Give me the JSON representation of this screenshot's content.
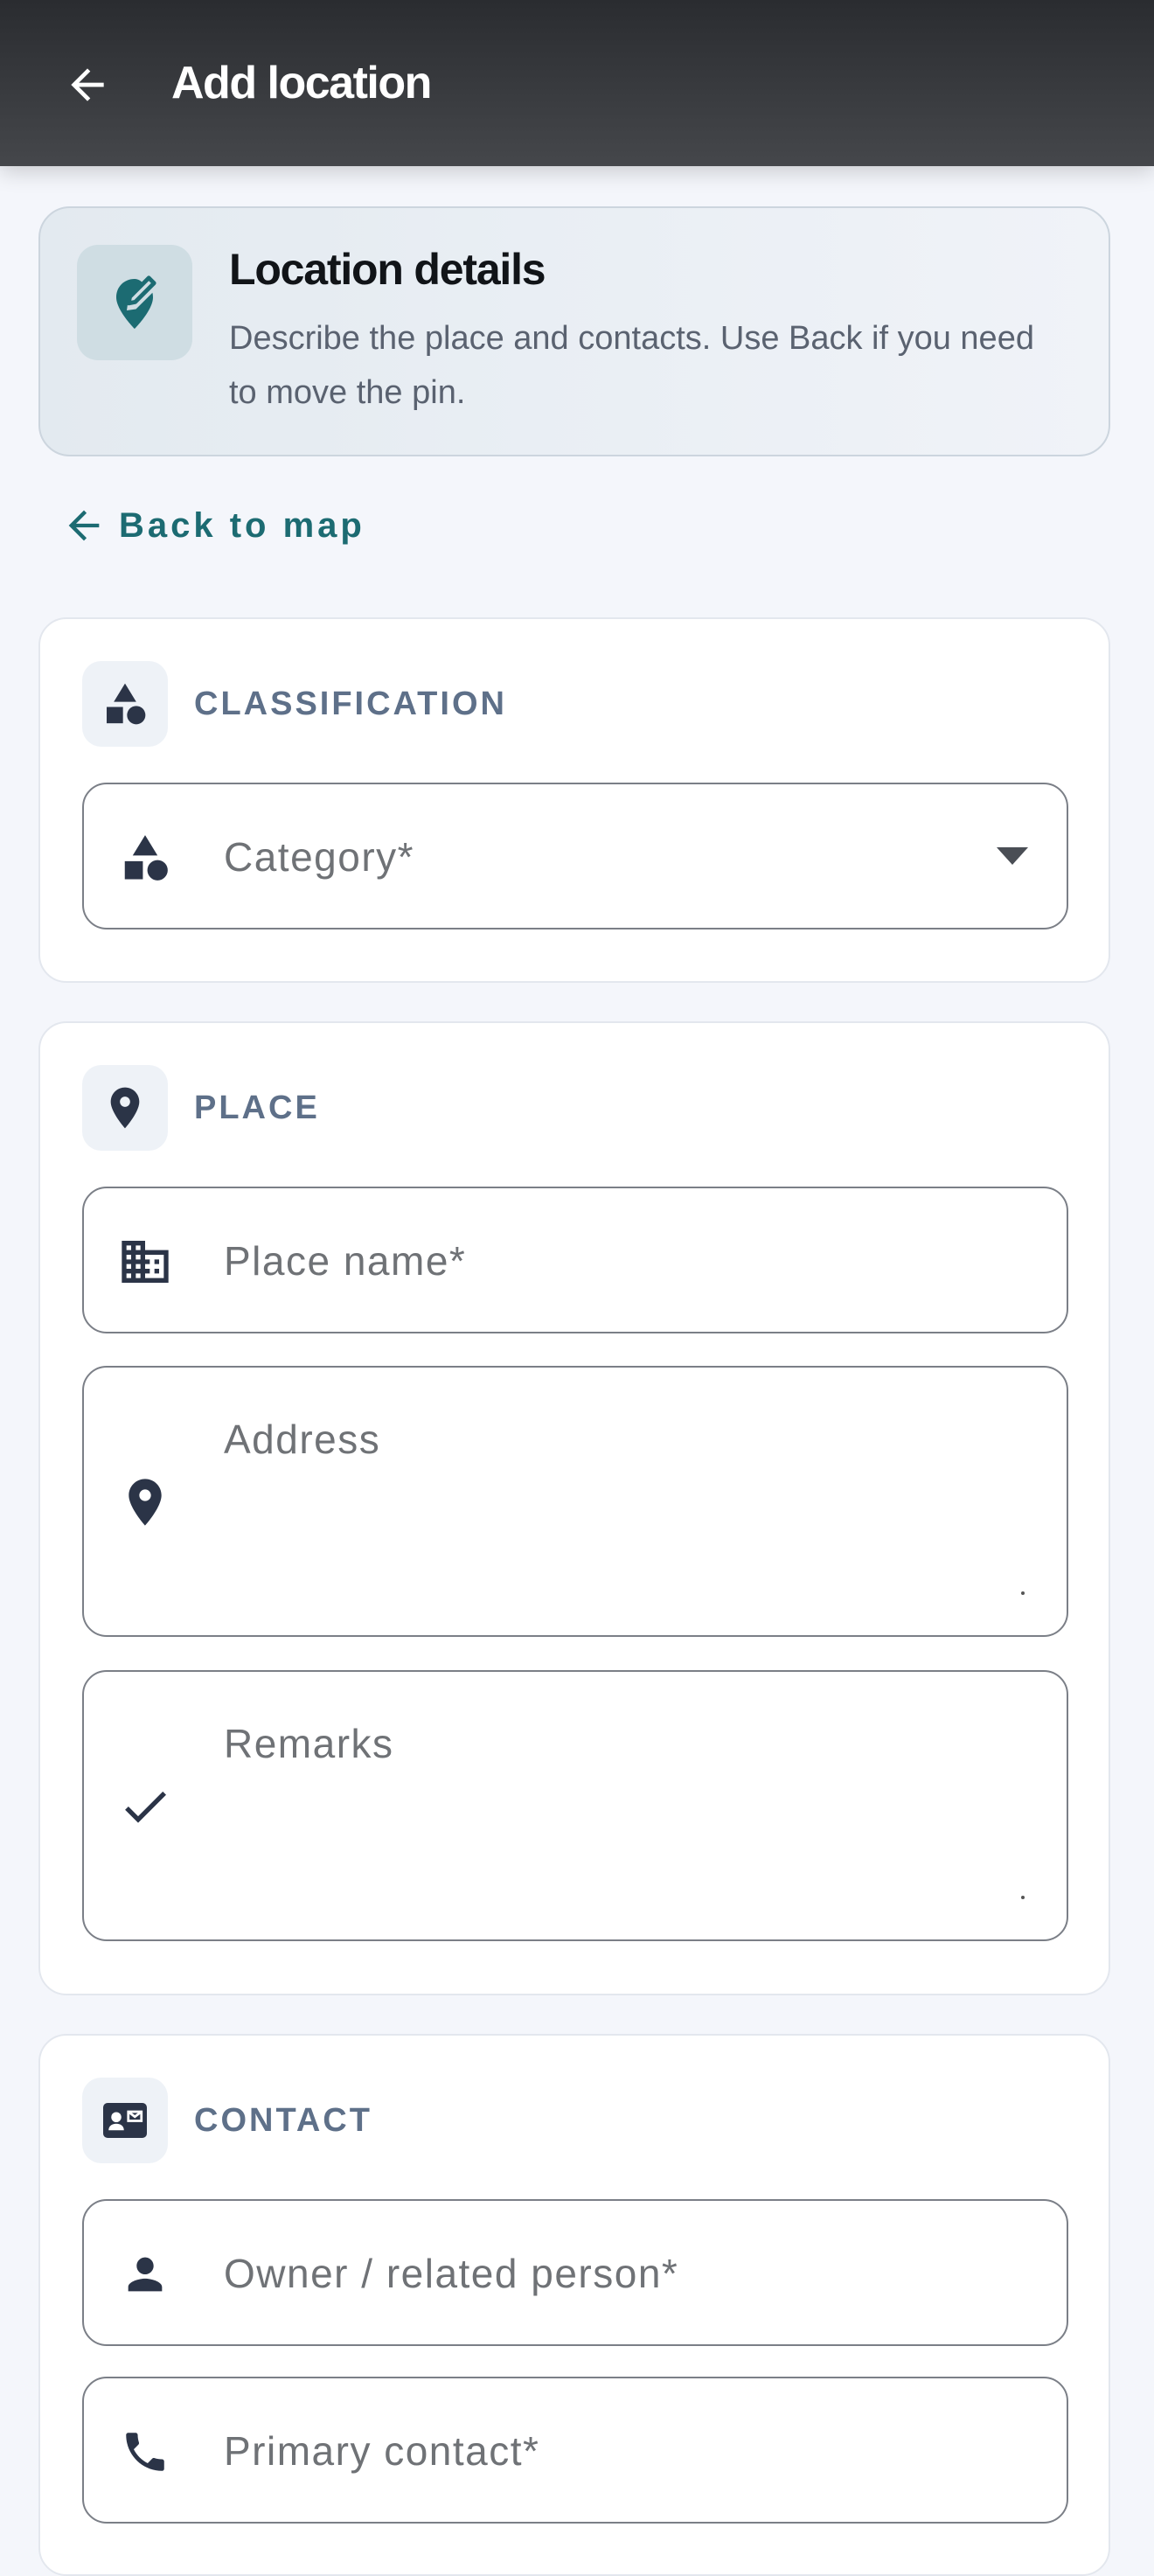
{
  "app_bar": {
    "title": "Add location",
    "back_icon": "arrow-left-icon"
  },
  "info_card": {
    "title": "Location details",
    "text": "Describe the place and contacts. Use Back if you need to move the pin.",
    "icon": "map-pin-edit-icon"
  },
  "back_link": {
    "label": "Back to map",
    "icon": "arrow-left-icon"
  },
  "classification": {
    "heading": "CLASSIFICATION",
    "category": {
      "placeholder": "Category*",
      "value": ""
    }
  },
  "place": {
    "heading": "PLACE",
    "place_name": {
      "placeholder": "Place name*",
      "value": ""
    },
    "address": {
      "placeholder": "Address",
      "value": ""
    },
    "remarks": {
      "placeholder": "Remarks",
      "value": ""
    }
  },
  "contact": {
    "heading": "CONTACT",
    "owner": {
      "placeholder": "Owner / related person*",
      "value": ""
    },
    "primary_contact": {
      "placeholder": "Primary contact*",
      "value": ""
    }
  },
  "colors": {
    "app_bar": "#2f3135",
    "accent": "#1c6b72",
    "section_label": "#5e7089",
    "field_border": "#7b7f87",
    "icon": "#2b3447"
  }
}
